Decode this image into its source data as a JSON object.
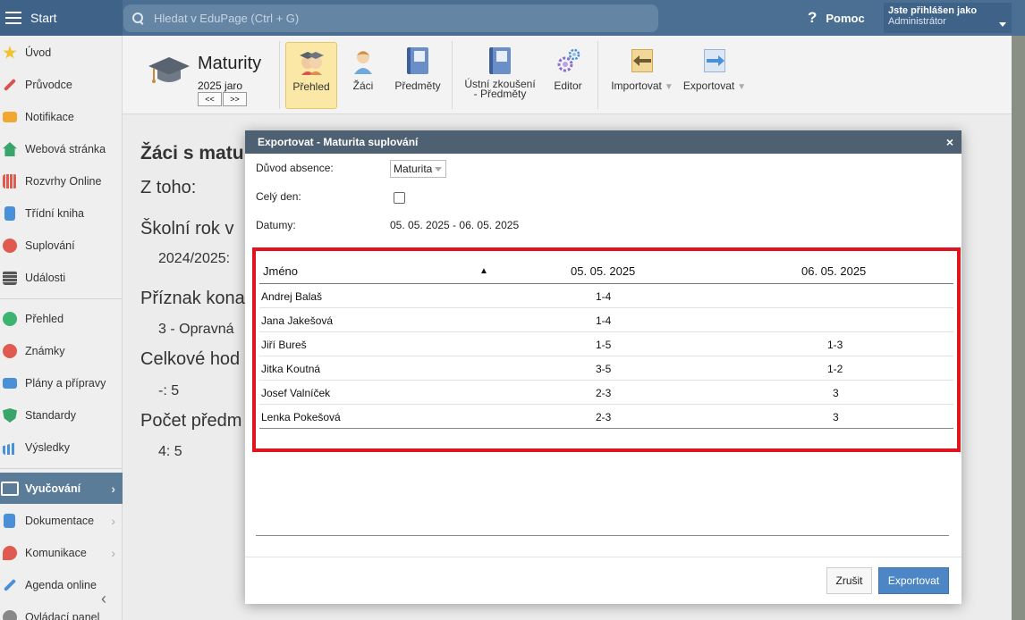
{
  "topbar": {
    "start_label": "Start",
    "search_placeholder": "Hledat v EduPage (Ctrl + G)",
    "help_label": "Pomoc",
    "user_line1": "Jste přihlášen jako",
    "user_line2": "Administrátor"
  },
  "sidebar": {
    "items": [
      {
        "label": "Úvod",
        "color": "#f2c12e"
      },
      {
        "label": "Průvodce",
        "color": "#d9534f"
      },
      {
        "label": "Notifikace",
        "color": "#f0a830"
      },
      {
        "label": "Webová stránka",
        "color": "#3aa56b"
      },
      {
        "label": "Rozvrhy Online",
        "color": "#e05a4f"
      },
      {
        "label": "Třídní kniha",
        "color": "#4a90d9"
      },
      {
        "label": "Suplování",
        "color": "#e05a4f"
      },
      {
        "label": "Události",
        "color": "#555555"
      },
      {
        "label": "Přehled",
        "color": "#3cb371"
      },
      {
        "label": "Známky",
        "color": "#e05a4f"
      },
      {
        "label": "Plány a přípravy",
        "color": "#4a90d9"
      },
      {
        "label": "Standardy",
        "color": "#3aa56b"
      },
      {
        "label": "Výsledky",
        "color": "#4a90d9"
      },
      {
        "label": "Vyučování",
        "color": "#ffffff"
      },
      {
        "label": "Dokumentace",
        "color": "#4a90d9"
      },
      {
        "label": "Komunikace",
        "color": "#e05a4f"
      },
      {
        "label": "Agenda online",
        "color": "#4a90d9"
      },
      {
        "label": "Ovládací panel",
        "color": "#888888"
      }
    ]
  },
  "toolbar": {
    "title": "Maturity",
    "subtitle": "2025 jaro",
    "prev_label": "<<",
    "next_label": ">>",
    "buttons": {
      "prehled": "Přehled",
      "zaci": "Žáci",
      "predmety": "Předměty",
      "ustni_line1": "Ústní zkoušení",
      "ustni_line2": "- Předměty",
      "editor": "Editor",
      "importovat": "Importovat",
      "exportovat": "Exportovat"
    }
  },
  "content": {
    "heading": "Žáci s matu",
    "z_toho": "Z toho:",
    "skolni_rok": "Školní rok v",
    "skolni_rok_val": "2024/2025:",
    "priznak": "Příznak kona",
    "priznak_val": "3 - Opravná",
    "celkove": "Celkové hod",
    "celkove_val": "-: 5",
    "pocet": "Počet předm",
    "pocet_val": "4: 5"
  },
  "modal": {
    "title": "Exportovat - Maturita suplování",
    "close_label": "×",
    "duvod_label": "Důvod absence:",
    "duvod_value": "Maturita",
    "cely_den_label": "Celý den:",
    "datumy_label": "Datumy:",
    "datumy_value": "05. 05. 2025 - 06. 05. 2025",
    "table": {
      "headers": {
        "name": "Jméno",
        "sort": "▲",
        "d1": "05. 05. 2025",
        "d2": "06. 05. 2025"
      },
      "rows": [
        {
          "name": "Andrej Balaš",
          "d1": "1-4",
          "d2": ""
        },
        {
          "name": "Jana Jakešová",
          "d1": "1-4",
          "d2": ""
        },
        {
          "name": "Jiří Bureš",
          "d1": "1-5",
          "d2": "1-3"
        },
        {
          "name": "Jitka Koutná",
          "d1": "3-5",
          "d2": "1-2"
        },
        {
          "name": "Josef Valníček",
          "d1": "2-3",
          "d2": "3"
        },
        {
          "name": "Lenka Pokešová",
          "d1": "2-3",
          "d2": "3"
        }
      ]
    },
    "cancel_label": "Zrušit",
    "export_label": "Exportovat"
  }
}
